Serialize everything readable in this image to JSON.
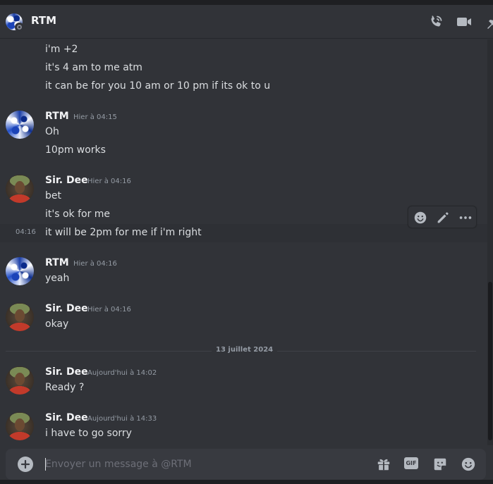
{
  "header": {
    "title": "RTM",
    "icons": [
      "phone-call-icon",
      "video-icon",
      "pin-icon"
    ]
  },
  "messages_continued": [
    "i'm +2",
    "it's 4 am to me atm",
    "it can be for you 10 am or 10 pm if its ok to u"
  ],
  "groups": [
    {
      "author": "RTM",
      "time": "Hier à 04:15",
      "lines": [
        "Oh",
        "10pm works"
      ]
    },
    {
      "author": "Sir. Dee",
      "time": "Hier à 04:16",
      "lines": [
        "bet",
        "it's ok for me",
        "it will be 2pm for me if i'm right"
      ],
      "hover_time": "04:16"
    },
    {
      "author": "RTM",
      "time": "Hier à 04:16",
      "lines": [
        "yeah"
      ]
    },
    {
      "author": "Sir. Dee",
      "time": "Hier à 04:16",
      "lines": [
        "okay"
      ]
    },
    {
      "author": "Sir. Dee",
      "time": "Aujourd'hui à 14:02",
      "lines": [
        "Ready ?"
      ]
    },
    {
      "author": "Sir. Dee",
      "time": "Aujourd'hui à 14:33",
      "lines": [
        "i have to go sorry"
      ]
    }
  ],
  "date_divider": "13 juillet 2024",
  "message_toolbar": [
    "add-reaction-icon",
    "edit-icon",
    "more-icon"
  ],
  "composer": {
    "placeholder": "Envoyer un message à @RTM",
    "value": "",
    "gif_label": "GIF",
    "icons": [
      "add-attachment-icon",
      "gift-icon",
      "gif-icon",
      "sticker-icon",
      "emoji-icon"
    ]
  },
  "colors": {
    "background": "#313338",
    "header_text": "#f2f3f5",
    "body_text": "#dbdee1",
    "muted_text": "#949ba4",
    "composer_bg": "#383a40"
  }
}
